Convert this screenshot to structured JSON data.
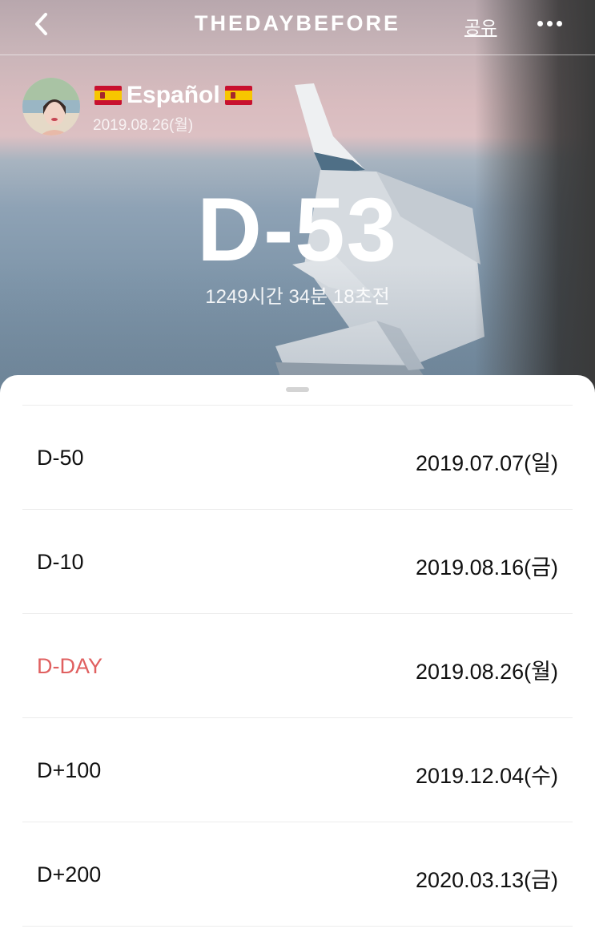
{
  "header": {
    "brand": "THEDAYBEFORE",
    "share_label": "공유"
  },
  "event": {
    "title": "Español",
    "date": "2019.08.26(월)",
    "countdown": "D-53",
    "time_remaining": "1249시간 34분 18초전"
  },
  "milestones": [
    {
      "label": "D-50",
      "date": "2019.07.07(일)"
    },
    {
      "label": "D-10",
      "date": "2019.08.16(금)"
    },
    {
      "label": "D-DAY",
      "date": "2019.08.26(월)"
    },
    {
      "label": "D+100",
      "date": "2019.12.04(수)"
    },
    {
      "label": "D+200",
      "date": "2020.03.13(금)"
    }
  ],
  "colors": {
    "highlight": "#e06060",
    "text": "#111111",
    "divider": "#ececec"
  },
  "icons": {
    "back": "chevron-left-icon",
    "more": "more-dots-icon",
    "flag": "spain-flag-icon"
  }
}
